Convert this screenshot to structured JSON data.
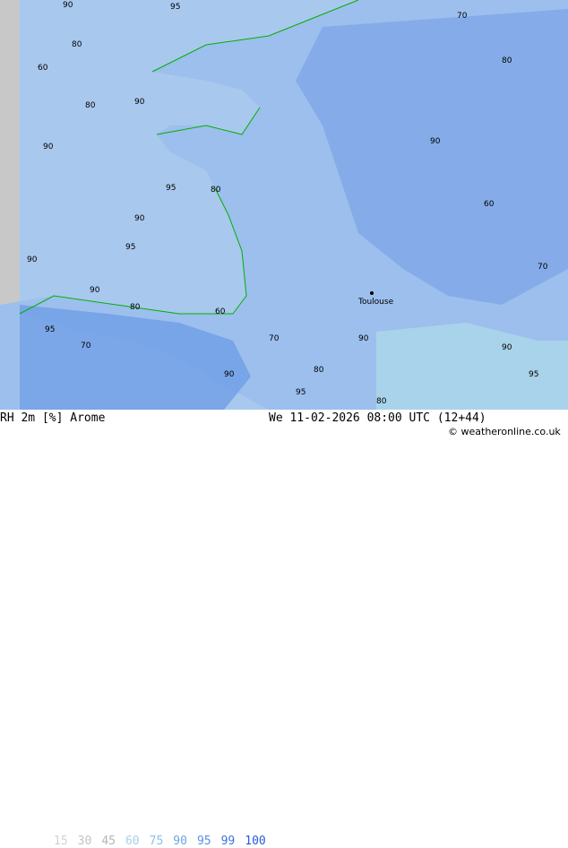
{
  "header": {
    "variable": "RH 2m [%] Arome",
    "datetime": "We 11-02-2026 08:00 UTC (12+44)",
    "credit": "© weatheronline.co.uk"
  },
  "legend": [
    {
      "value": "15",
      "color": "#d2d2d2"
    },
    {
      "value": "30",
      "color": "#c3c3c3"
    },
    {
      "value": "45",
      "color": "#b4b4b4"
    },
    {
      "value": "60",
      "color": "#a9cfe8"
    },
    {
      "value": "75",
      "color": "#8fbde6"
    },
    {
      "value": "90",
      "color": "#6fa3e6"
    },
    {
      "value": "95",
      "color": "#5a8fe6"
    },
    {
      "value": "99",
      "color": "#3f73e0"
    },
    {
      "value": "100",
      "color": "#2a5ad6"
    }
  ],
  "map": {
    "city_label": "Toulouse",
    "sea_color": "#a9c8ee",
    "land_color": "#9cbfed",
    "humid_color": "#6f9de6",
    "contour_labels": [
      "90",
      "95",
      "80",
      "60",
      "80",
      "90",
      "90",
      "95",
      "80",
      "90",
      "95",
      "90",
      "90",
      "80",
      "95",
      "70",
      "60",
      "70",
      "80",
      "90",
      "95",
      "90",
      "80",
      "90",
      "95",
      "70",
      "80",
      "90",
      "60",
      "70"
    ]
  }
}
